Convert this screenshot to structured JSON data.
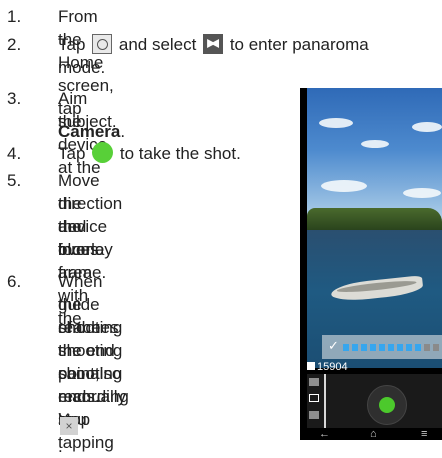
{
  "steps": [
    {
      "num": "1.",
      "pre": "From the Home screen, tap ",
      "bold": "Camera",
      "post": "."
    },
    {
      "num": "2.",
      "a": "Tap ",
      "b": " and select ",
      "c": " to enter panaroma",
      "d": "mode.",
      "icons": [
        "camera-mode-icon",
        "panorama-mode-icon"
      ]
    },
    {
      "num": "3.",
      "lines": [
        "Aim the device at the",
        "subject."
      ]
    },
    {
      "num": "4.",
      "a": "Tap ",
      "b": " to take the shot.",
      "icon": "shutter-icon",
      "icon_color": "#58d038"
    },
    {
      "num": "5.",
      "lines": [
        "Move the device in one",
        "direction and overlay",
        "the focus area with the",
        "blue frame."
      ]
    },
    {
      "num": "6.",
      "lines": [
        "When the shooting",
        "guide reaches the end",
        "of the shooting point,",
        "the shooting ends. You",
        "can also manually stop",
        "recording by tapping"
      ],
      "end": ".",
      "icon": "stop-x-icon",
      "icon_glyph": "×"
    }
  ],
  "phone": {
    "shot_count": "15904",
    "guide_progress": 0.75,
    "colors": {
      "guide_filled": "#36a6ee",
      "guide_empty": "#8a8a8a",
      "shutter": "#4cc92c"
    },
    "nav_icons": [
      {
        "name": "back-icon",
        "glyph": "←"
      },
      {
        "name": "home-icon",
        "glyph": "⌂"
      },
      {
        "name": "menu-icon",
        "glyph": "≡"
      }
    ]
  }
}
